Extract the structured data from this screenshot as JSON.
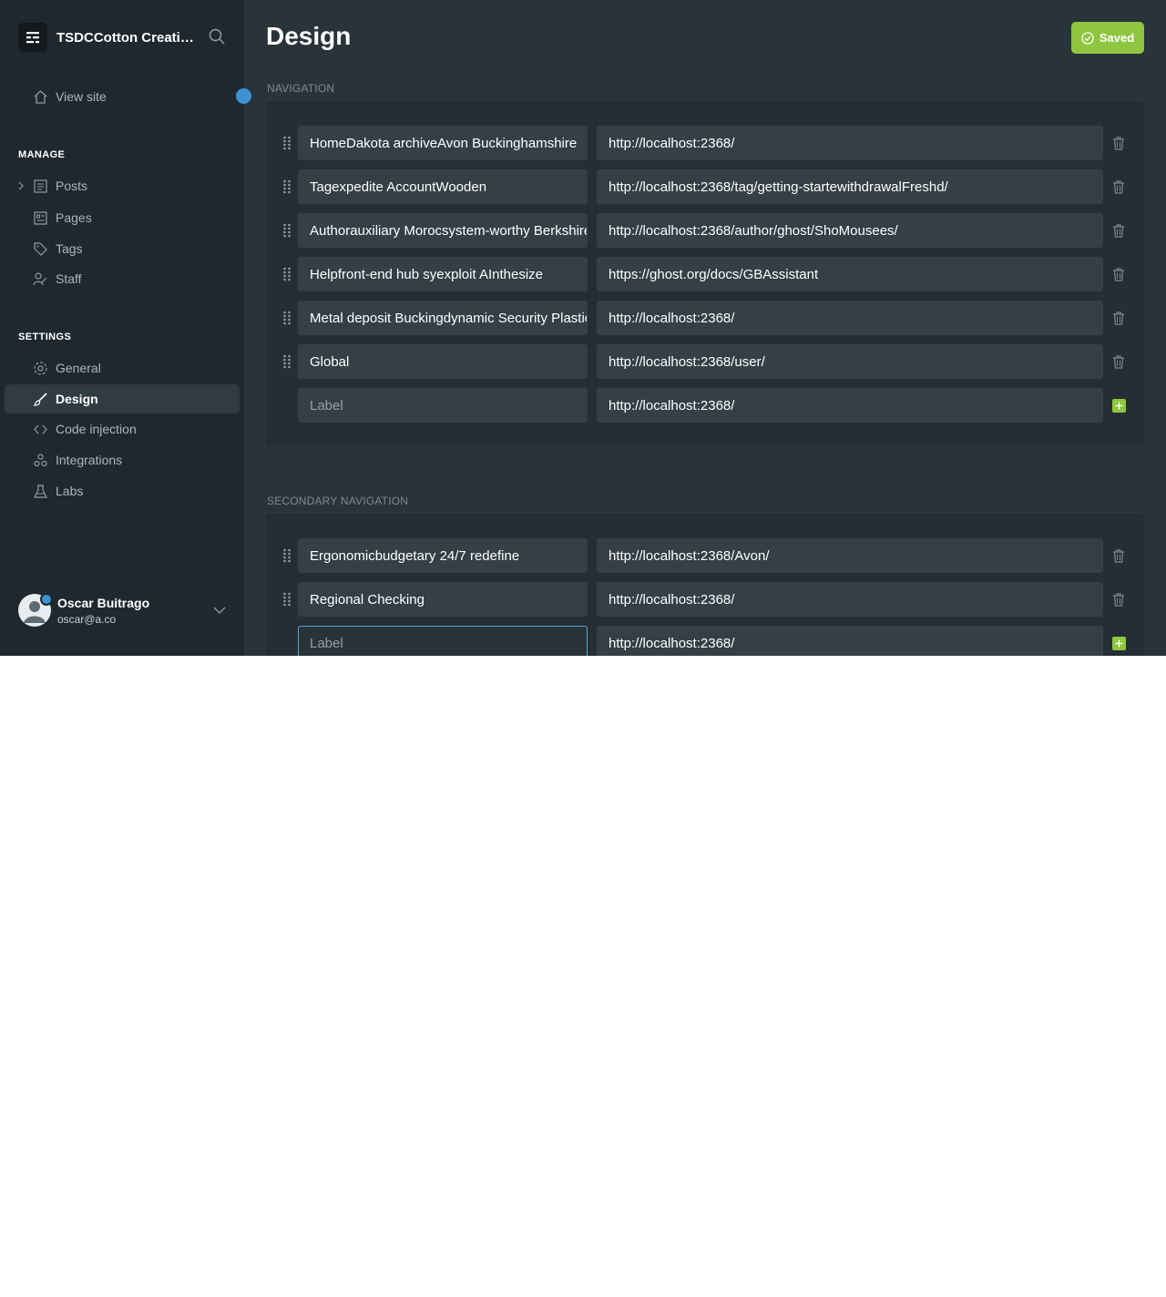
{
  "sidebar": {
    "brand": "TSDCCotton Creative",
    "view_site": "View site",
    "manage_heading": "MANAGE",
    "manage_items": [
      "Posts",
      "Pages",
      "Tags",
      "Staff"
    ],
    "settings_heading": "SETTINGS",
    "settings_items": [
      "General",
      "Design",
      "Code injection",
      "Integrations",
      "Labs"
    ],
    "active_item": "Design"
  },
  "user": {
    "name": "Oscar Buitrago",
    "email": "oscar@a.co"
  },
  "header": {
    "title": "Design",
    "saved_label": "Saved"
  },
  "navigation": {
    "heading": "NAVIGATION",
    "items": [
      {
        "label": "HomeDakota archiveAvon Buckinghamshire",
        "url": "http://localhost:2368/"
      },
      {
        "label": "Tagexpedite AccountWooden",
        "url": "http://localhost:2368/tag/getting-startewithdrawalFreshd/"
      },
      {
        "label": "Authorauxiliary Morocsystem-worthy Berkshire",
        "url": "http://localhost:2368/author/ghost/ShoMousees/"
      },
      {
        "label": "Helpfront-end hub syexploit AInthesize",
        "url": "https://ghost.org/docs/GBAssistant"
      },
      {
        "label": "Metal deposit Buckingdynamic Security Plastic",
        "url": "http://localhost:2368/"
      },
      {
        "label": "Global",
        "url": "http://localhost:2368/user/"
      }
    ],
    "new_label_placeholder": "Label",
    "new_url_value": "http://localhost:2368/"
  },
  "secondary_navigation": {
    "heading": "SECONDARY NAVIGATION",
    "items": [
      {
        "label": "Ergonomicbudgetary 24/7 redefine",
        "url": "http://localhost:2368/Avon/"
      },
      {
        "label": "Regional Checking",
        "url": "http://localhost:2368/"
      }
    ],
    "new_label_placeholder": "Label",
    "new_url_value": "http://localhost:2368/"
  },
  "colors": {
    "accent_green": "#8ec63f",
    "focus_blue": "#5ba6d6",
    "sidebar_bg": "#1f282e",
    "main_bg": "#29333a"
  }
}
